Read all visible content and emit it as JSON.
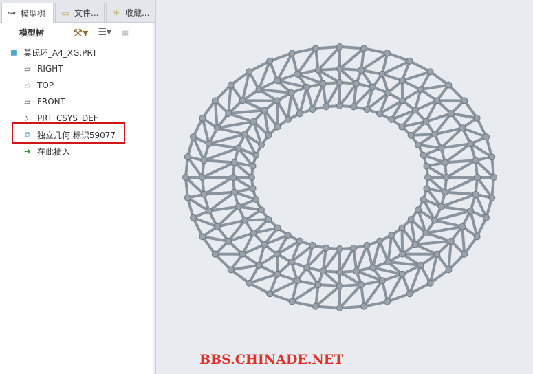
{
  "tabs": [
    {
      "label": "模型树",
      "icon": "model-tree-icon"
    },
    {
      "label": "文件...",
      "icon": "folder-icon"
    },
    {
      "label": "收藏...",
      "icon": "favorites-folder-icon"
    }
  ],
  "toolbar": {
    "title": "模型树"
  },
  "tree": {
    "root": "莫氏环_A4_XG.PRT",
    "items": [
      {
        "label": "RIGHT",
        "icon": "datum-plane-icon"
      },
      {
        "label": "TOP",
        "icon": "datum-plane-icon"
      },
      {
        "label": "FRONT",
        "icon": "datum-plane-icon"
      },
      {
        "label": "PRT_CSYS_DEF",
        "icon": "csys-icon"
      },
      {
        "label": "独立几何 标识59077",
        "icon": "independent-geometry-icon"
      },
      {
        "label": "在此插入",
        "icon": "insert-here-arrow-icon"
      }
    ]
  },
  "watermark": "BBS.CHINADE.NET",
  "colors": {
    "highlight": "#d01616",
    "strut": "#8a949e",
    "watermark": "#e0302a"
  }
}
